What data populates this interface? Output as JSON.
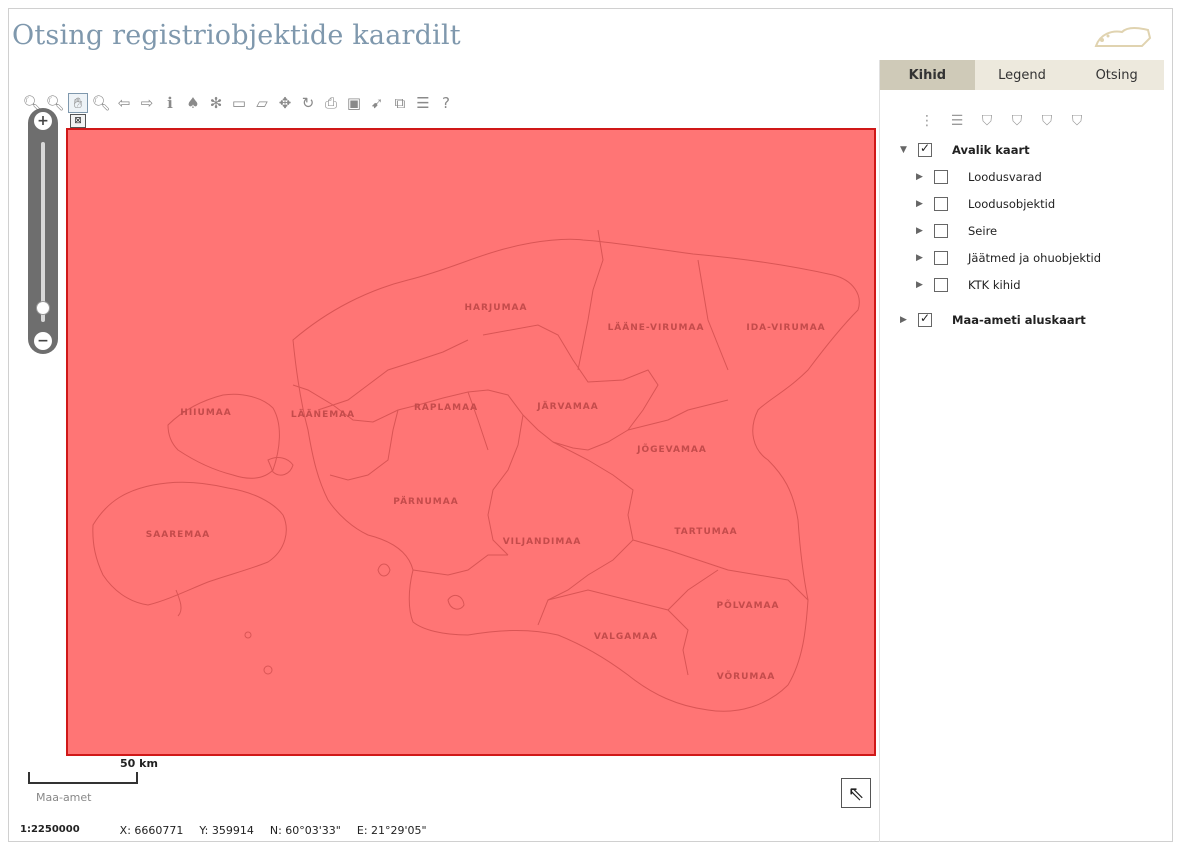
{
  "page_title": "Otsing registriobjektide kaardilt",
  "toolbar_icons": [
    "zoom-in-icon",
    "zoom-out-icon",
    "pan-hand-icon",
    "zoom-box-icon",
    "back-arrow-icon",
    "forward-arrow-icon",
    "info-icon",
    "binoculars-icon",
    "select-icon",
    "measure-line-icon",
    "measure-area-icon",
    "move-icon",
    "refresh-icon",
    "print-icon",
    "export-pdf-icon",
    "pin-icon",
    "fullscreen-icon",
    "list-icon",
    "help-icon"
  ],
  "tabs": [
    {
      "label": "Kihid",
      "active": true
    },
    {
      "label": "Legend",
      "active": false
    },
    {
      "label": "Otsing",
      "active": false
    }
  ],
  "layer_tools": [
    "expand-tree-icon",
    "list-icon",
    "filter-icon",
    "filter-icon",
    "filter-icon",
    "filter-icon"
  ],
  "layers": [
    {
      "label": "Avalik kaart",
      "checked": true,
      "expanded": true,
      "bold": true,
      "children": [
        {
          "label": "Loodusvarad",
          "checked": false
        },
        {
          "label": "Loodusobjektid",
          "checked": false
        },
        {
          "label": "Seire",
          "checked": false
        },
        {
          "label": "Jäätmed ja ohuobjektid",
          "checked": false
        },
        {
          "label": "KTK kihid",
          "checked": false
        }
      ]
    },
    {
      "label": "Maa-ameti aluskaart",
      "checked": true,
      "expanded": false,
      "bold": true
    }
  ],
  "map": {
    "overlay_color": "#ff7575",
    "border_color": "#d01818",
    "counties": [
      "HARJUMAA",
      "LÄÄNE-VIRUMAA",
      "IDA-VIRUMAA",
      "HIIUMAA",
      "LÄÄNEMAA",
      "RAPLAMAA",
      "JÄRVAMAA",
      "JÕGEVAMAA",
      "PÄRNUMAA",
      "SAAREMAA",
      "VILJANDIMAA",
      "TARTUMAA",
      "PÕLVAMAA",
      "VALGAMAA",
      "VÕRUMAA"
    ]
  },
  "zoom": {
    "plus": "+",
    "minus": "−",
    "level": 0.08
  },
  "scale_bar": {
    "label": "50 km"
  },
  "attribution": "Maa-amet",
  "status": {
    "scale": "1:2250000",
    "x": "X: 6660771",
    "y": "Y: 359914",
    "n": "N: 60°03'33\"",
    "e": "E: 21°29'05\""
  },
  "colors": {
    "title": "#7f98ad",
    "tab_bg": "#ede9dd",
    "tab_active_bg": "#cfcab8"
  }
}
